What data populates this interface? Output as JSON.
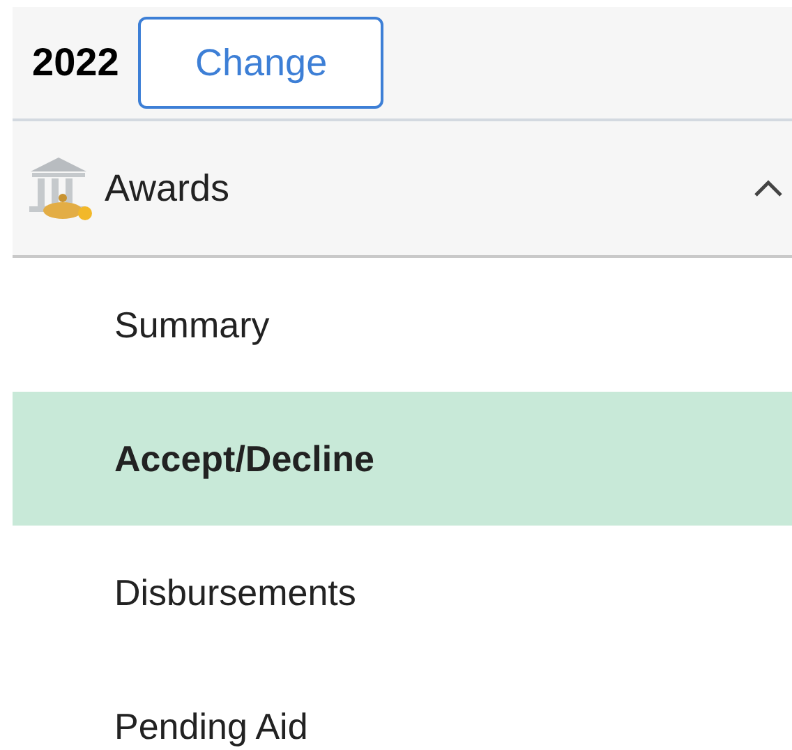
{
  "header": {
    "year": "2022",
    "change_button": "Change"
  },
  "section": {
    "title": "Awards",
    "expanded": true
  },
  "items": [
    {
      "label": "Summary",
      "selected": false
    },
    {
      "label": "Accept/Decline",
      "selected": true
    },
    {
      "label": "Disbursements",
      "selected": false
    },
    {
      "label": "Pending Aid",
      "selected": false
    }
  ]
}
